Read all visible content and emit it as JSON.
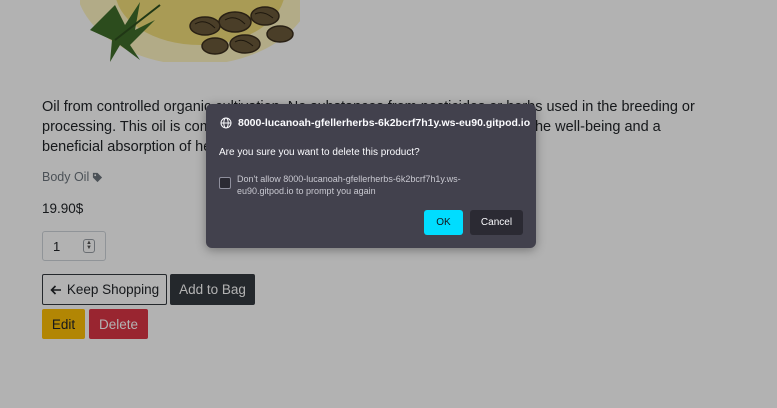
{
  "product": {
    "description": "Oil from controlled organic cultivation. No substances from pesticides or herbs used in the breeding or processing. This oil is composed of valuable fatty acids which contributes to the well-being and a beneficial absorption of herbs.",
    "category": "Body Oil",
    "price": "19.90$",
    "quantity": "1"
  },
  "buttons": {
    "keep_shopping": "Keep Shopping",
    "add_to_bag": "Add to Bag",
    "edit": "Edit",
    "delete": "Delete"
  },
  "dialog": {
    "origin": "8000-lucanoah-gfellerherbs-6k2bcrf7h1y.ws-eu90.gitpod.io",
    "message": "Are you sure you want to delete this product?",
    "checkbox_label": "Don't allow 8000-lucanoah-gfellerherbs-6k2bcrf7h1y.ws-eu90.gitpod.io to prompt you again",
    "ok_label": "OK",
    "cancel_label": "Cancel",
    "checkbox_checked": false
  },
  "colors": {
    "dialog_bg": "#42414d",
    "ok_accent": "#00ddff",
    "edit": "#ffc107",
    "delete": "#dc3545",
    "dark_button": "#343a40"
  },
  "icons": {
    "category": "tag-icon",
    "keep_shopping": "arrow-left-icon",
    "dialog_origin": "globe-icon"
  }
}
